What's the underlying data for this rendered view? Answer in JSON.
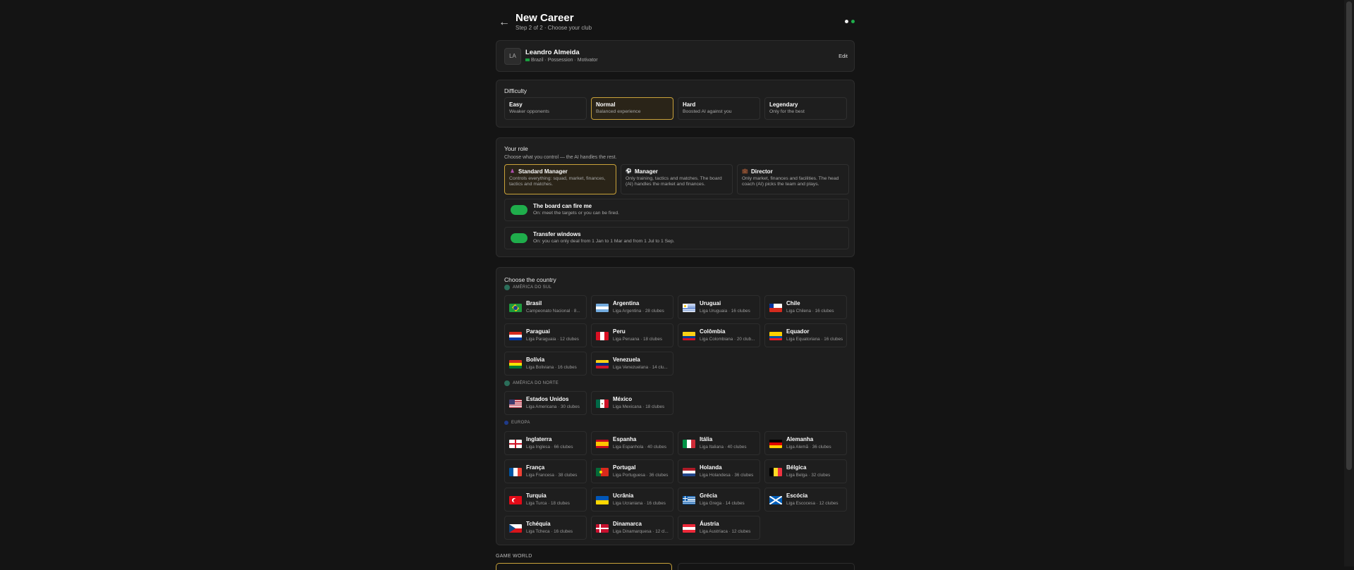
{
  "header": {
    "title": "New Career",
    "subtitle": "Step 2 of 2 · Choose your club",
    "dot_colors": [
      "#f0f0f0",
      "#1fad4b"
    ]
  },
  "coach": {
    "initials": "LA",
    "name": "Leandro Almeida",
    "meta": "Brazil · Possession · Motivator",
    "edit_label": "Edit"
  },
  "difficulty": {
    "title": "Difficulty",
    "options": [
      {
        "name": "Easy",
        "desc": "Weaker opponents"
      },
      {
        "name": "Normal",
        "desc": "Balanced experience"
      },
      {
        "name": "Hard",
        "desc": "Boosted AI against you"
      },
      {
        "name": "Legendary",
        "desc": "Only for the best"
      }
    ],
    "selected": "Normal"
  },
  "role": {
    "title": "Your role",
    "subtitle": "Choose what you control — the AI handles the rest.",
    "options": [
      {
        "name": "Standard Manager",
        "desc": "Controls everything: squad, market, finances, tactics and matches."
      },
      {
        "name": "Manager",
        "desc": "Only training, tactics and matches. The board (AI) handles the market and finances."
      },
      {
        "name": "Director",
        "desc": "Only market, finances and facilities. The head coach (AI) picks the team and plays."
      }
    ],
    "selected": "Standard Manager",
    "toggles": [
      {
        "title": "The board can fire me",
        "desc": "On: meet the targets or you can be fired.",
        "on": true
      },
      {
        "title": "Transfer windows",
        "desc": "On: you can only deal from 1 Jan to 1 Mar and from 1 Jul to 1 Sep.",
        "on": true
      }
    ]
  },
  "country": {
    "title": "Choose the country",
    "regions": [
      {
        "name": "AMÉRICA DO SUL",
        "countries": [
          {
            "name": "Brasil",
            "league": "Campeonato Nacional · 8..."
          },
          {
            "name": "Argentina",
            "league": "Liga Argentina · 28 clubes"
          },
          {
            "name": "Uruguai",
            "league": "Liga Uruguaia · 16 clubes"
          },
          {
            "name": "Chile",
            "league": "Liga Chilena · 16 clubes"
          },
          {
            "name": "Paraguai",
            "league": "Liga Paraguaia · 12 clubes"
          },
          {
            "name": "Peru",
            "league": "Liga Peruana · 18 clubes"
          },
          {
            "name": "Colômbia",
            "league": "Liga Colombiana · 20 club..."
          },
          {
            "name": "Equador",
            "league": "Liga Equatoriana · 16 clubes"
          },
          {
            "name": "Bolívia",
            "league": "Liga Boliviana · 16 clubes"
          },
          {
            "name": "Venezuela",
            "league": "Liga Venezuelana · 14 clu..."
          }
        ]
      },
      {
        "name": "AMÉRICA DO NORTE",
        "countries": [
          {
            "name": "Estados Unidos",
            "league": "Liga Americana · 30 clubes"
          },
          {
            "name": "México",
            "league": "Liga Mexicana · 18 clubes"
          }
        ]
      },
      {
        "name": "EUROPA",
        "countries": [
          {
            "name": "Inglaterra",
            "league": "Liga Inglesa · 66 clubes"
          },
          {
            "name": "Espanha",
            "league": "Liga Espanhola · 40 clubes"
          },
          {
            "name": "Itália",
            "league": "Liga Italiana · 40 clubes"
          },
          {
            "name": "Alemanha",
            "league": "Liga Alemã · 36 clubes"
          },
          {
            "name": "França",
            "league": "Liga Francesa · 38 clubes"
          },
          {
            "name": "Portugal",
            "league": "Liga Portuguesa · 36 clubes"
          },
          {
            "name": "Holanda",
            "league": "Liga Holandesa · 36 clubes"
          },
          {
            "name": "Bélgica",
            "league": "Liga Belga · 32 clubes"
          },
          {
            "name": "Turquia",
            "league": "Liga Turca · 18 clubes"
          },
          {
            "name": "Ucrânia",
            "league": "Liga Ucraniana · 16 clubes"
          },
          {
            "name": "Grécia",
            "league": "Liga Grega · 14 clubes"
          },
          {
            "name": "Escócia",
            "league": "Liga Escocesa · 12 clubes"
          },
          {
            "name": "Tchéquia",
            "league": "Liga Tcheca · 16 clubes"
          },
          {
            "name": "Dinamarca",
            "league": "Liga Dinamarquesa · 12 cl..."
          },
          {
            "name": "Áustria",
            "league": "Liga Austríaca · 12 clubes"
          }
        ]
      }
    ]
  },
  "game_world": {
    "title": "GAME WORLD"
  },
  "colors": {
    "accent": "#c9a23a",
    "toggle_on": "#1fad4b"
  }
}
